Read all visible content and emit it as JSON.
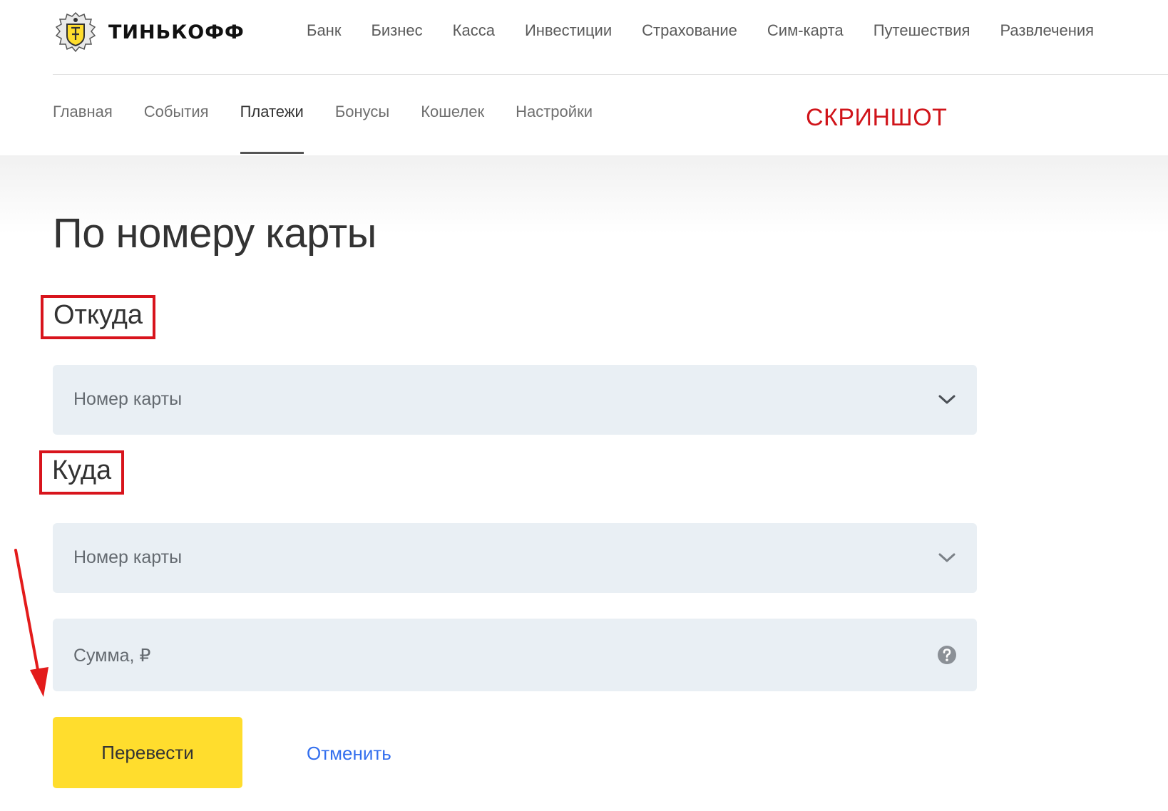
{
  "header": {
    "brand": "ТИНЬКОФФ",
    "nav": [
      "Банк",
      "Бизнес",
      "Касса",
      "Инвестиции",
      "Страхование",
      "Сим-карта",
      "Путешествия",
      "Развлечения"
    ]
  },
  "subnav": {
    "items": [
      "Главная",
      "События",
      "Платежи",
      "Бонусы",
      "Кошелек",
      "Настройки"
    ],
    "active": "Платежи"
  },
  "watermark": "СКРИНШОТ",
  "page": {
    "title": "По номеру карты"
  },
  "form": {
    "from_label": "Откуда",
    "from_placeholder": "Номер карты",
    "to_label": "Куда",
    "to_placeholder": "Номер карты",
    "amount_placeholder": "Сумма, ₽",
    "submit_label": "Перевести",
    "cancel_label": "Отменить"
  },
  "colors": {
    "accent_yellow": "#ffdd2d",
    "link_blue": "#336fee",
    "annotation_red": "#d8141c",
    "field_bg": "#e9eff4"
  },
  "icons": {
    "dropdown": "chevron-down-icon",
    "help": "question-circle-icon",
    "annotation": "red-arrow-icon"
  }
}
